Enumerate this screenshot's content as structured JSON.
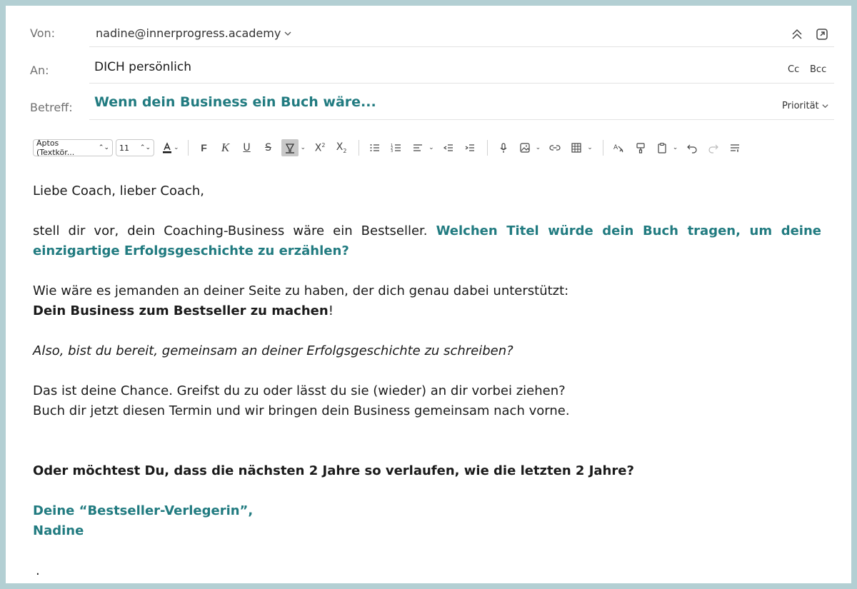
{
  "header": {
    "from_label": "Von:",
    "from_value": "nadine@innerprogress.academy",
    "to_label": "An:",
    "to_value": "DICH persönlich",
    "cc_label": "Cc",
    "bcc_label": "Bcc",
    "subject_label": "Betreff:",
    "subject_value": "Wenn dein Business ein Buch wäre...",
    "priority_label": "Priorität"
  },
  "toolbar": {
    "font_family": "Aptos (Textkör...",
    "font_size": "11",
    "bold_label": "F",
    "italic_label": "K",
    "underline_label": "U",
    "strike_label": "S"
  },
  "body": {
    "greeting": "Liebe Coach, lieber Coach,",
    "p1_plain": "stell dir vor, dein Coaching-Business wäre ein Bestseller. ",
    "p1_teal": "Welchen Titel würde dein Buch tragen, um deine einzigartige Erfolgsgeschichte zu erzählen?",
    "p2_line1": "Wie wäre es jemanden an deiner Seite zu haben, der dich genau dabei unterstützt:",
    "p2_bold": "Dein Business zum Bestseller zu machen",
    "p2_end": "!",
    "p3_italic": "Also, bist du bereit,  gemeinsam an deiner Erfolgsgeschichte zu schreiben?",
    "p4_line1": "Das ist deine Chance. Greifst du zu oder lässt du sie (wieder) an dir vorbei ziehen?",
    "p4_line2": "Buch dir jetzt diesen Termin und wir bringen dein Business gemeinsam nach vorne.",
    "p5_bold": "Oder möchtest Du, dass die nächsten 2 Jahre so verlaufen, wie die letzten 2 Jahre?",
    "sign_line1": "Deine “Bestseller-Verlegerin”,",
    "sign_line2": "Nadine",
    "trailing_dot": "."
  },
  "colors": {
    "accent": "#217b80",
    "frame": "#b3cfd3"
  }
}
